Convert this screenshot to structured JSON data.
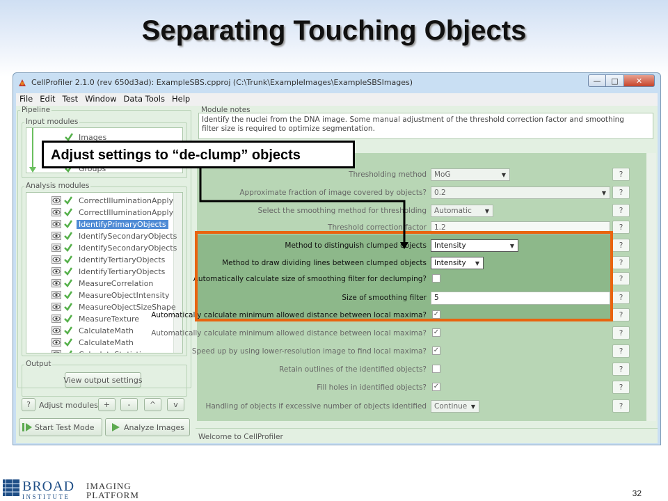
{
  "slide": {
    "title": "Separating Touching Objects",
    "callout": "Adjust settings to “de-clump” objects",
    "page_number": "32",
    "logo": {
      "broad": "BROAD",
      "institute": "INSTITUTE",
      "imaging": "IMAGING",
      "platform": "PLATFORM"
    }
  },
  "window": {
    "title": "CellProfiler 2.1.0 (rev 650d3ad): ExampleSBS.cpproj (C:\\Trunk\\ExampleImages\\ExampleSBSImages)",
    "controls": {
      "minimize": "—",
      "maximize": "□",
      "close": "✕"
    }
  },
  "menu": [
    {
      "label": "File"
    },
    {
      "label": "Edit"
    },
    {
      "label": "Test"
    },
    {
      "label": "Window"
    },
    {
      "label": "Data Tools"
    },
    {
      "label": "Help"
    }
  ],
  "pipeline": {
    "label": "Pipeline",
    "input_label": "Input modules",
    "input_modules": [
      "Images",
      "Groups"
    ],
    "analysis_label": "Analysis modules",
    "analysis_modules": [
      "CorrectIlluminationApply",
      "CorrectIlluminationApply",
      "IdentifyPrimaryObjects",
      "IdentifySecondaryObjects",
      "IdentifySecondaryObjects",
      "IdentifyTertiaryObjects",
      "IdentifyTertiaryObjects",
      "MeasureCorrelation",
      "MeasureObjectIntensity",
      "MeasureObjectSizeShape",
      "MeasureTexture",
      "CalculateMath",
      "CalculateMath",
      "CalculateStatistics"
    ],
    "selected_index": 2,
    "output_label": "Output",
    "view_output": "View output settings",
    "adjust": {
      "help": "?",
      "label": "Adjust modules:",
      "add": "+",
      "remove": "-",
      "up": "^",
      "down": "v"
    },
    "start_test": "Start Test Mode",
    "analyze": "Analyze Images"
  },
  "module_notes": {
    "label": "Module notes",
    "text": "Identify the nuclei from the DNA image. Some manual adjustment of the threshold correction factor and  smoothing filter size is required to optimize segmentation."
  },
  "settings": [
    {
      "label": "Thresholding method",
      "kind": "combo",
      "value": "MoG"
    },
    {
      "label": "Approximate fraction of image covered by objects?",
      "kind": "combo-wide",
      "value": "0.2"
    },
    {
      "label": "Select the smoothing method for thresholding",
      "kind": "combo",
      "value": "Automatic"
    },
    {
      "label": "Threshold correction factor",
      "kind": "text",
      "value": "1.2"
    },
    {
      "label": "Method to distinguish clumped objects",
      "kind": "combo",
      "value": "Intensity",
      "highlight": true
    },
    {
      "label": "Method to draw dividing lines between clumped objects",
      "kind": "combo",
      "value": "Intensity",
      "highlight": true
    },
    {
      "label": "Automatically calculate size of smoothing filter for declumping?",
      "kind": "check",
      "checked": false,
      "highlight": true
    },
    {
      "label": "Size of smoothing filter",
      "kind": "text",
      "value": "5",
      "highlight": true
    },
    {
      "label": "Automatically calculate minimum allowed distance between local maxima?",
      "kind": "check",
      "checked": true,
      "highlight": true
    },
    {
      "label": "Automatically calculate minimum allowed distance between local maxima?",
      "kind": "check",
      "checked": true
    },
    {
      "label": "Speed up by using lower-resolution image to find local maxima?",
      "kind": "check",
      "checked": true
    },
    {
      "label": "Retain outlines of the identified objects?",
      "kind": "check",
      "checked": false
    },
    {
      "label": "Fill holes in identified objects?",
      "kind": "check",
      "checked": true
    },
    {
      "label": "Handling of objects if excessive number of objects identified",
      "kind": "combo",
      "value": "Continue"
    }
  ],
  "help_label": "?",
  "status": "Welcome to CellProfiler",
  "colors": {
    "highlight_border": "#e9640f",
    "selected_module": "#4f8bd5",
    "logo_blue": "#1f4e86"
  }
}
